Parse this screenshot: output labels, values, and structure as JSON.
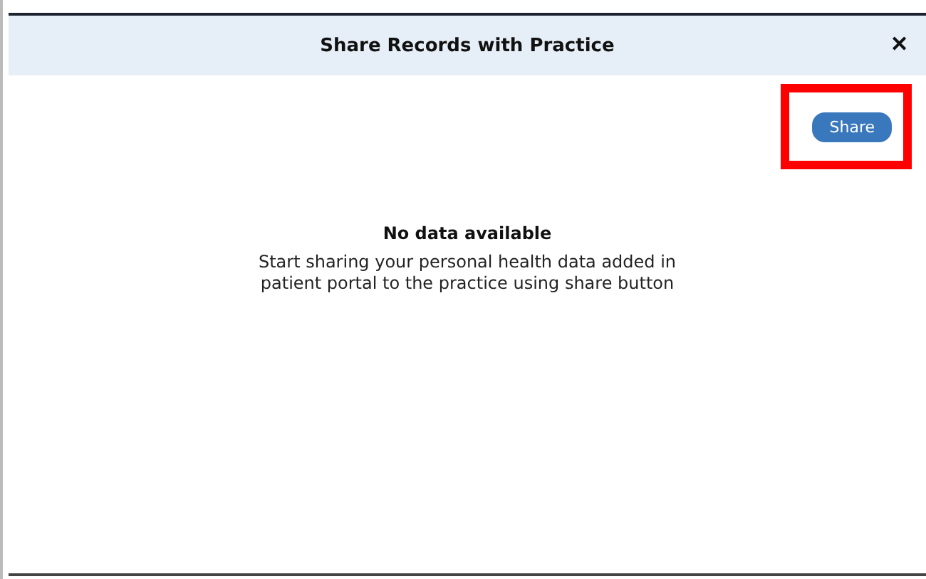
{
  "dialog": {
    "title": "Share Records with Practice",
    "close": "✕"
  },
  "toolbar": {
    "share_button": "Share",
    "highlighted": true
  },
  "empty_state": {
    "title": "No data available",
    "message": "Start sharing your personal health data added in patient portal to the practice using share button"
  }
}
